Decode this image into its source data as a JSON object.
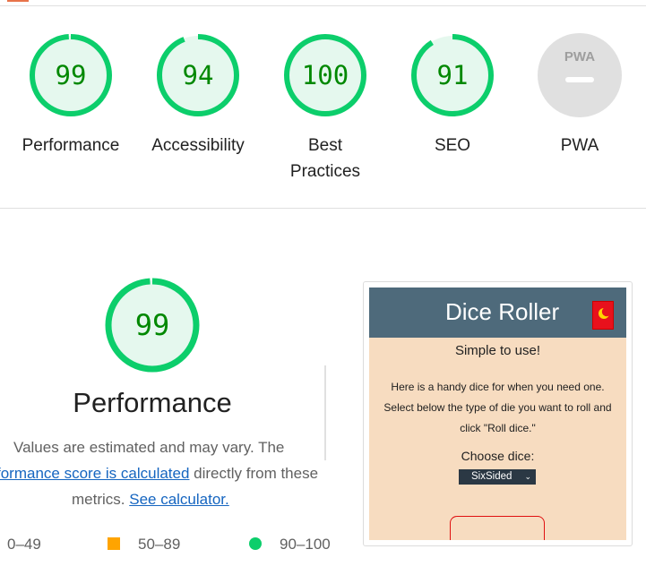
{
  "summary": {
    "categories": [
      {
        "score": "99",
        "label": "Performance",
        "value": 0.99
      },
      {
        "score": "94",
        "label": "Accessibility",
        "value": 0.94
      },
      {
        "score": "100",
        "label": "Best Practices",
        "value": 1.0
      },
      {
        "score": "91",
        "label": "SEO",
        "value": 0.91
      }
    ],
    "pwa": {
      "badge": "PWA",
      "label": "PWA"
    }
  },
  "performance": {
    "score": "99",
    "value": 0.99,
    "title": "Performance",
    "desc_line1": "Values are estimated and may vary. The",
    "desc_link1": "formance score is calculated",
    "desc_after_link1": " directly from these",
    "desc_prefix3": "metrics. ",
    "desc_link2": "See calculator."
  },
  "legend": {
    "red": "0–49",
    "orange": "50–89",
    "green": "90–100"
  },
  "screenshot": {
    "title": "Dice Roller",
    "subtitle": "Simple to use!",
    "description": "Here is a handy dice for when you need one. Select below the type of die you want to roll and click \"Roll dice.\"",
    "choose_label": "Choose dice:",
    "select_value": "SixSided"
  },
  "colors": {
    "pass": "#0cce6b",
    "pass_text": "#008800",
    "pass_fill": "#e5f8ee",
    "average": "#ffa400",
    "link": "#1565c0",
    "app_header": "#4e6a7b",
    "app_bg": "#f7dcc0"
  }
}
